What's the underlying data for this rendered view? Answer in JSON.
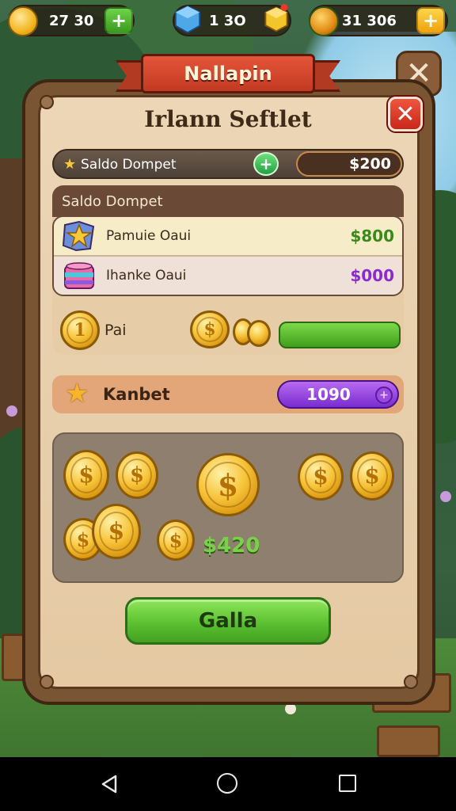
{
  "hud": {
    "coins_value": "27 30",
    "gems_value": "1 3O",
    "gold_value": "31 306"
  },
  "dialog": {
    "ribbon_title": "Nallapin",
    "title": "Irlann Seftlet",
    "wallet": {
      "label": "Saldo Dompet",
      "amount": "$200"
    },
    "section": {
      "title": "Saldo Dompet",
      "items": [
        {
          "label": "Pamuie Oaui",
          "value": "$800",
          "icon": "star-map-icon"
        },
        {
          "label": "Ihanke Oaui",
          "value": "$000",
          "icon": "cake-box-icon"
        }
      ]
    },
    "bonus_label": "Pai",
    "kanbet": {
      "label": "Kanbet",
      "value": "1090"
    },
    "treasure_amount": "$420",
    "action_button": "Galla"
  },
  "colors": {
    "panel": "#e4c9a3",
    "ribbon": "#d94a30",
    "button_green": "#5cc131",
    "pill_purple": "#8f3ce0"
  }
}
